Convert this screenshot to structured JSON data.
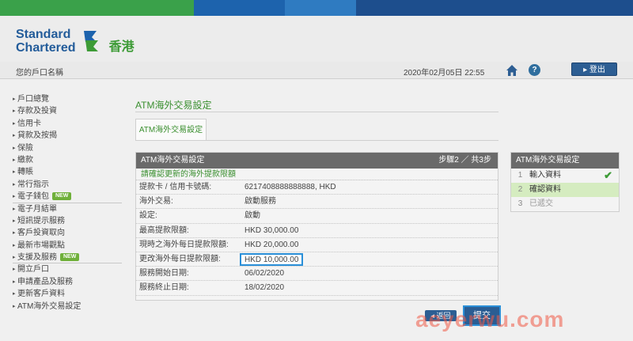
{
  "colors": {
    "brand_blue": "#235c9a",
    "brand_green": "#3d9b36",
    "accent_highlight": "#2a8fd8",
    "panel_header": "#6a6a6a"
  },
  "top_bar_colors": [
    "#3aa14a",
    "#1d63ad",
    "#2f7bc1",
    "#1d4e8d"
  ],
  "logo": {
    "text_line1": "Standard",
    "text_line2": "Chartered",
    "region": "香港"
  },
  "userrow": {
    "account_name": "您的戶口名稱",
    "datetime": "2020年02月05日 22:55",
    "logout": "登出",
    "help": "?"
  },
  "sidebar": {
    "items": [
      {
        "label": "戶口總覽"
      },
      {
        "label": "存款及投資"
      },
      {
        "label": "信用卡"
      },
      {
        "label": "貸款及按揭"
      },
      {
        "label": "保險"
      },
      {
        "label": "繳款"
      },
      {
        "label": "轉賬"
      },
      {
        "label": "常行指示"
      },
      {
        "label": "電子錢包",
        "badge": "NEW"
      },
      {
        "label": "電子月結單"
      },
      {
        "label": "短訊提示服務"
      },
      {
        "label": "客戶投資取向"
      },
      {
        "label": "最新市場觀點"
      },
      {
        "label": "支援及服務",
        "badge": "NEW"
      },
      {
        "label": "開立戶口"
      },
      {
        "label": "申請產品及服務"
      },
      {
        "label": "更新客戶資料"
      },
      {
        "label": "ATM海外交易設定"
      }
    ]
  },
  "main": {
    "title": "ATM海外交易設定",
    "tab": "ATM海外交易設定",
    "panel": {
      "header": "ATM海外交易設定",
      "step": "步驟2 ／ 共3步",
      "intro": "請確認更新的海外提款限額",
      "rows": [
        {
          "label": "提款卡 / 信用卡號碼:",
          "value": "6217408888888888, HKD"
        },
        {
          "label": "海外交易:",
          "value": "啟動服務"
        },
        {
          "label": "設定:",
          "value": "啟動"
        },
        {
          "label": "最高提款限額:",
          "value": "HKD 30,000.00"
        },
        {
          "label": "現時之海外每日提款限額:",
          "value": "HKD 20,000.00"
        },
        {
          "label": "更改海外每日提款限額:",
          "value": "HKD 10,000.00"
        },
        {
          "label": "服務開始日期:",
          "value": "06/02/2020"
        },
        {
          "label": "服務終止日期:",
          "value": "18/02/2020"
        }
      ]
    }
  },
  "steps": {
    "header": "ATM海外交易設定",
    "items": [
      {
        "num": "1",
        "label": "輸入資料",
        "state": "done"
      },
      {
        "num": "2",
        "label": "確認資料",
        "state": "current"
      },
      {
        "num": "3",
        "label": "已遞交",
        "state": "pending"
      }
    ]
  },
  "buttons": {
    "back": "◂ 返回",
    "submit": "提交"
  },
  "watermark": "aeyerwu.com"
}
